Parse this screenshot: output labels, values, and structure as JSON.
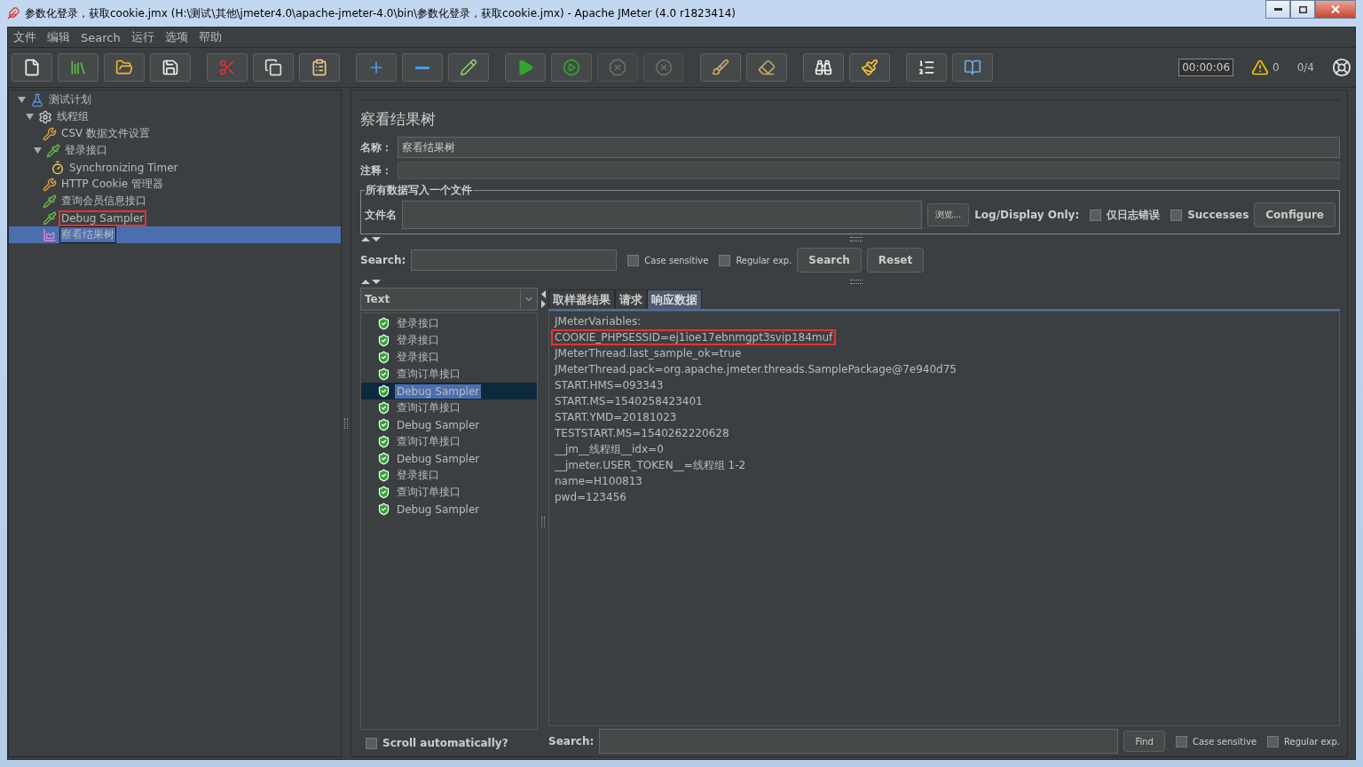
{
  "window": {
    "title": "参数化登录，获取cookie.jmx (H:\\测试\\其他\\jmeter4.0\\apache-jmeter-4.0\\bin\\参数化登录，获取cookie.jmx) - Apache JMeter (4.0 r1823414)"
  },
  "menu": [
    "文件",
    "编辑",
    "Search",
    "运行",
    "选项",
    "帮助"
  ],
  "toolbar": {
    "buttons": [
      {
        "kind": "new",
        "disabled": false
      },
      {
        "kind": "templates",
        "disabled": false
      },
      {
        "kind": "open",
        "disabled": false
      },
      {
        "kind": "save",
        "disabled": false
      },
      {
        "kind": "cut",
        "disabled": false
      },
      {
        "kind": "copy",
        "disabled": false
      },
      {
        "kind": "paste",
        "disabled": false
      },
      {
        "kind": "expand",
        "disabled": false
      },
      {
        "kind": "collapse",
        "disabled": false
      },
      {
        "kind": "toggle",
        "disabled": false
      },
      {
        "kind": "start",
        "disabled": false
      },
      {
        "kind": "start_no_pause",
        "disabled": false
      },
      {
        "kind": "stop",
        "disabled": true
      },
      {
        "kind": "shutdown",
        "disabled": true
      },
      {
        "kind": "clear",
        "disabled": false
      },
      {
        "kind": "clear_all",
        "disabled": false
      },
      {
        "kind": "search",
        "disabled": false
      },
      {
        "kind": "reset_search",
        "disabled": false
      },
      {
        "kind": "functions",
        "disabled": false
      },
      {
        "kind": "help",
        "disabled": false
      }
    ],
    "timer": "00:00:06",
    "warnings": "0",
    "threads": "0/4"
  },
  "tree": [
    {
      "label": "测试计划",
      "kind": "plan",
      "expanded": true,
      "selected": false,
      "highlighted": false,
      "children": [
        {
          "label": "线程组",
          "kind": "threadgroup",
          "expanded": true,
          "selected": false,
          "highlighted": false,
          "children": [
            {
              "label": "CSV 数据文件设置",
              "kind": "config",
              "selected": false,
              "highlighted": false
            },
            {
              "label": "登录接口",
              "kind": "sampler",
              "expanded": true,
              "selected": false,
              "highlighted": false,
              "children": [
                {
                  "label": "Synchronizing Timer",
                  "kind": "timer",
                  "selected": false,
                  "highlighted": false
                }
              ]
            },
            {
              "label": "HTTP Cookie 管理器",
              "kind": "config",
              "selected": false,
              "highlighted": false
            },
            {
              "label": "查询会员信息接口",
              "kind": "sampler",
              "selected": false,
              "highlighted": false
            },
            {
              "label": "Debug Sampler",
              "kind": "sampler",
              "selected": false,
              "highlighted": true
            },
            {
              "label": "察看结果树",
              "kind": "listener",
              "selected": true,
              "highlighted": false
            }
          ]
        }
      ]
    }
  ],
  "panel": {
    "title": "察看结果树",
    "name_label": "名称：",
    "name_value": "察看结果树",
    "comment_label": "注释：",
    "file_group": {
      "legend": "所有数据写入一个文件",
      "file_label": "文件名",
      "browse": "浏览...",
      "log_label": "Log/Display Only:",
      "errors": {
        "label": "仅日志错误",
        "checked": false
      },
      "successes": {
        "label": "Successes",
        "checked": false
      },
      "configure": "Configure"
    },
    "search": {
      "label": "Search:",
      "case": {
        "label": "Case sensitive",
        "checked": false
      },
      "regex": {
        "label": "Regular exp.",
        "checked": false
      },
      "search_button": "Search",
      "reset_button": "Reset"
    }
  },
  "results": {
    "renderer": "Text",
    "items": [
      {
        "label": "登录接口",
        "selected": false
      },
      {
        "label": "登录接口",
        "selected": false
      },
      {
        "label": "登录接口",
        "selected": false
      },
      {
        "label": "查询订单接口",
        "selected": false
      },
      {
        "label": "Debug Sampler",
        "selected": true
      },
      {
        "label": "查询订单接口",
        "selected": false
      },
      {
        "label": "Debug Sampler",
        "selected": false
      },
      {
        "label": "查询订单接口",
        "selected": false
      },
      {
        "label": "Debug Sampler",
        "selected": false
      },
      {
        "label": "登录接口",
        "selected": false
      },
      {
        "label": "查询订单接口",
        "selected": false
      },
      {
        "label": "Debug Sampler",
        "selected": false
      }
    ],
    "scroll_auto": {
      "label": "Scroll automatically?",
      "checked": false
    }
  },
  "tabs": [
    {
      "label": "取样器结果",
      "selected": false
    },
    {
      "label": "请求",
      "selected": false
    },
    {
      "label": "响应数据",
      "selected": true
    }
  ],
  "response": {
    "lines": [
      {
        "text": "JMeterVariables:",
        "highlighted": false
      },
      {
        "text": "COOKIE_PHPSESSID=ej1ioe17ebnmgpt3svip184muf",
        "highlighted": true
      },
      {
        "text": "JMeterThread.last_sample_ok=true",
        "highlighted": false
      },
      {
        "text": "JMeterThread.pack=org.apache.jmeter.threads.SamplePackage@7e940d75",
        "highlighted": false
      },
      {
        "text": "START.HMS=093343",
        "highlighted": false
      },
      {
        "text": "START.MS=1540258423401",
        "highlighted": false
      },
      {
        "text": "START.YMD=20181023",
        "highlighted": false
      },
      {
        "text": "TESTSTART.MS=1540262220628",
        "highlighted": false
      },
      {
        "text": "__jm__线程组__idx=0",
        "highlighted": false
      },
      {
        "text": "__jmeter.USER_TOKEN__=线程组 1-2",
        "highlighted": false
      },
      {
        "text": "name=H100813",
        "highlighted": false
      },
      {
        "text": "pwd=123456",
        "highlighted": false
      }
    ]
  },
  "bottom_search": {
    "label": "Search:",
    "find": "Find",
    "case": {
      "label": "Case sensitive",
      "checked": false
    },
    "regex": {
      "label": "Regular exp.",
      "checked": false
    }
  }
}
